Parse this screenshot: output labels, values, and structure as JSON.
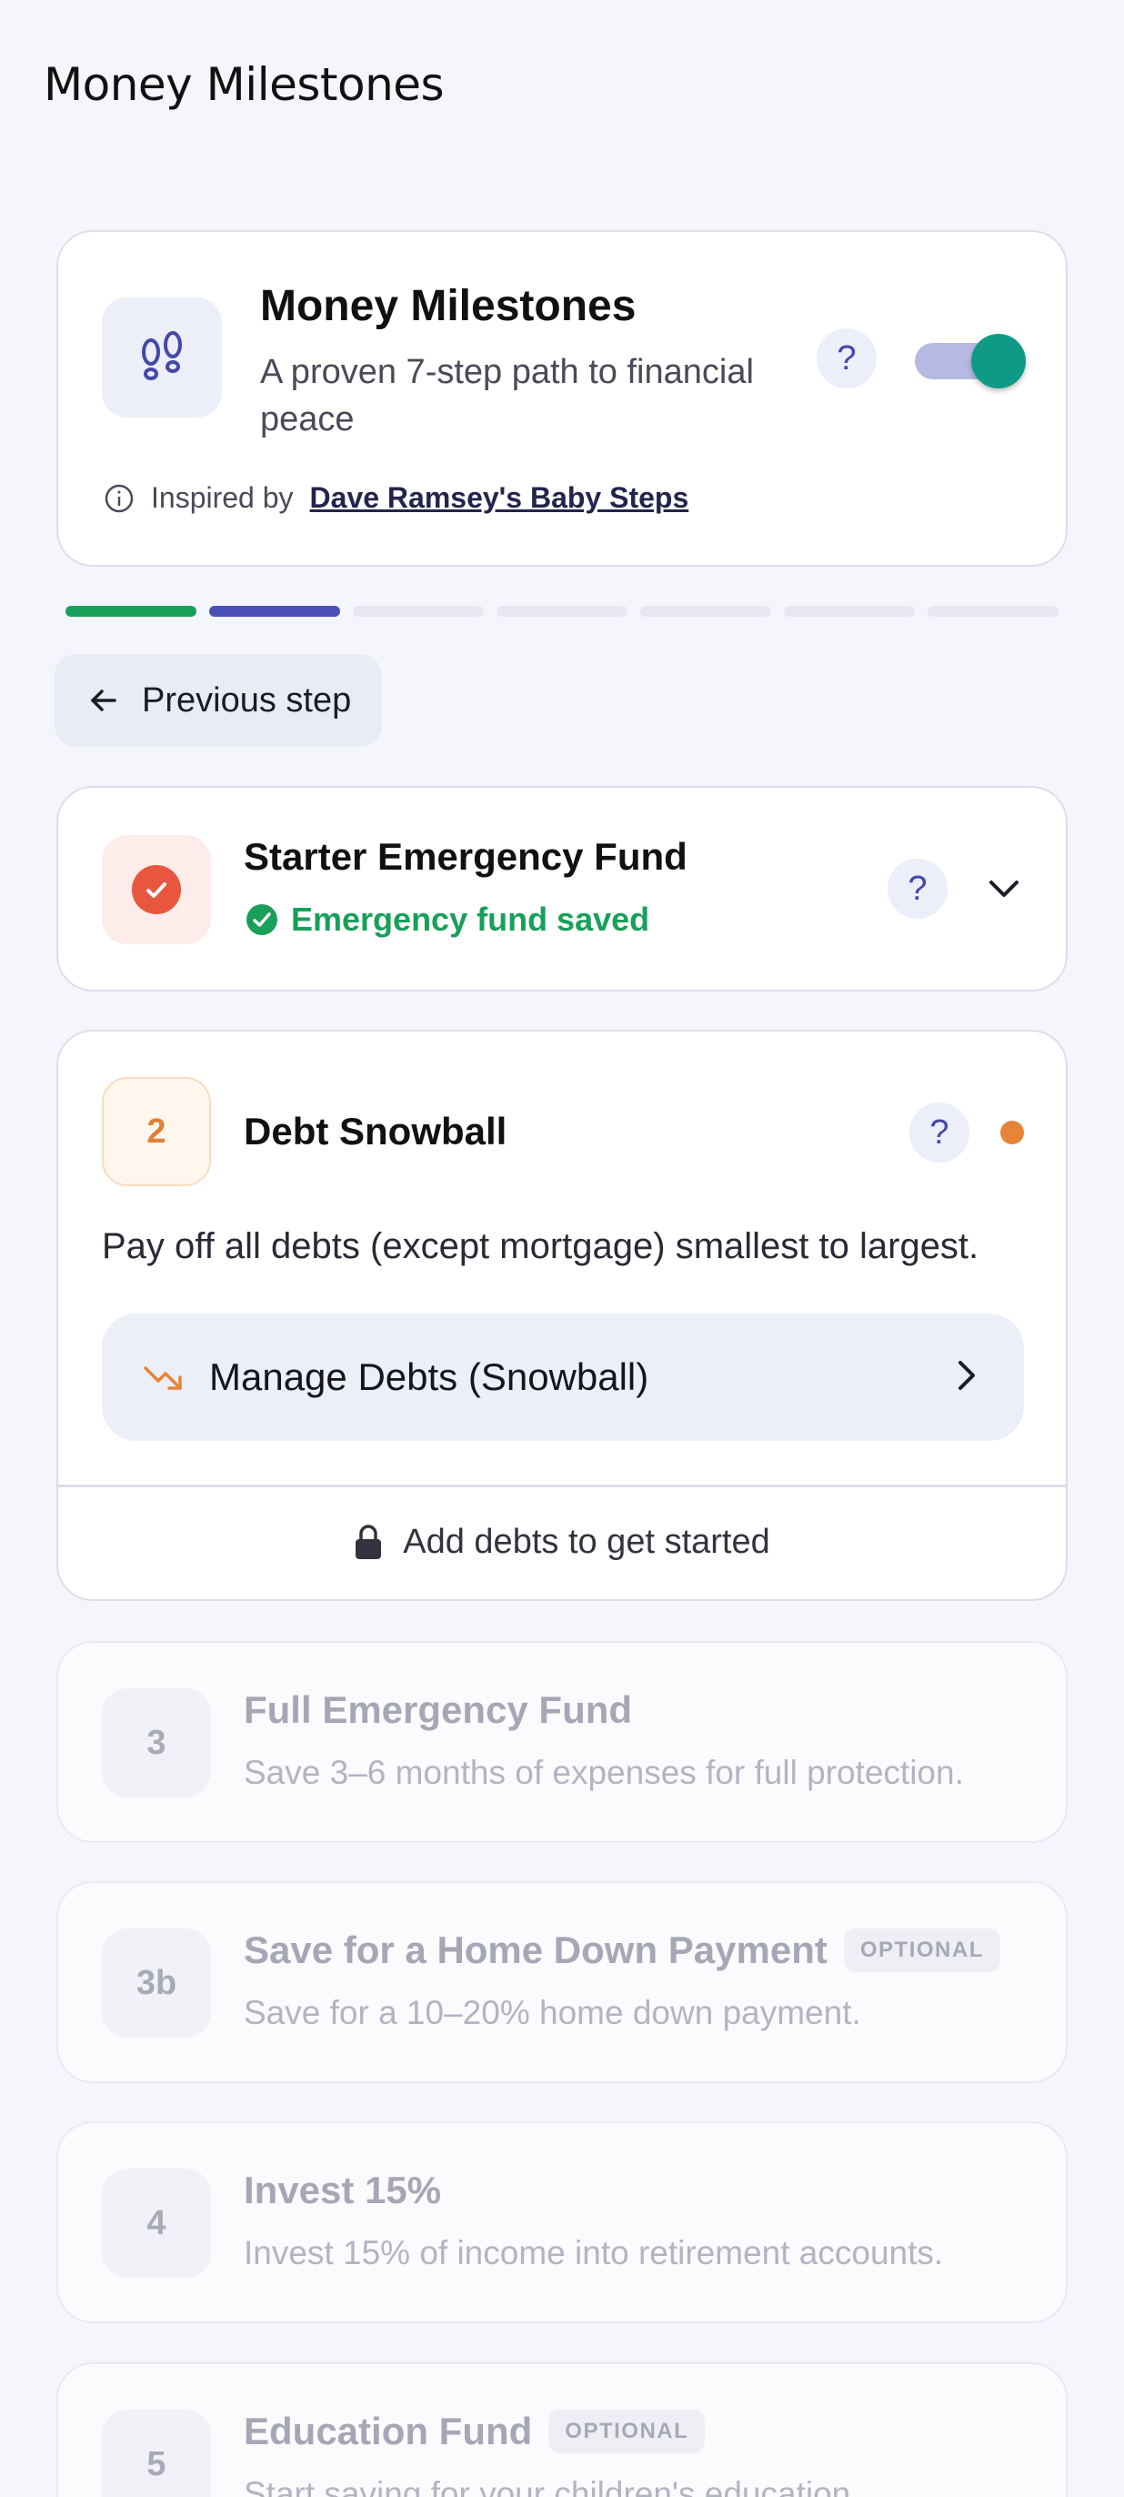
{
  "page": {
    "title": "Money Milestones"
  },
  "header_card": {
    "title": "Money Milestones",
    "subtitle": "A proven 7-step path to financial peace",
    "help_label": "?",
    "toggle_on": true,
    "inspired_prefix": "Inspired by",
    "inspired_link": "Dave Ramsey's Baby Steps",
    "icon": "footsteps-icon"
  },
  "progress": {
    "segments": [
      {
        "state": "complete",
        "color": "#18a05a"
      },
      {
        "state": "current",
        "color": "#4a4fb8"
      },
      {
        "state": "todo",
        "color": "#e6e7f0"
      },
      {
        "state": "todo",
        "color": "#e6e7f0"
      },
      {
        "state": "todo",
        "color": "#e6e7f0"
      },
      {
        "state": "todo",
        "color": "#e6e7f0"
      },
      {
        "state": "todo",
        "color": "#e6e7f0"
      }
    ]
  },
  "prev_button": {
    "label": "Previous step",
    "icon": "arrow-left-icon"
  },
  "steps": [
    {
      "title": "Starter Emergency Fund",
      "status": "Emergency fund saved",
      "help_label": "?",
      "state": "complete"
    },
    {
      "number": "2",
      "title": "Debt Snowball",
      "help_label": "?",
      "description": "Pay off all debts (except mortgage) smallest to largest.",
      "action_label": "Manage Debts (Snowball)",
      "footer": "Add debts to get started",
      "state": "active"
    },
    {
      "number": "3",
      "title": "Full Emergency Fund",
      "description": "Save 3–6 months of expenses for full protection.",
      "state": "locked"
    },
    {
      "number": "3b",
      "title": "Save for a Home Down Payment",
      "badge": "OPTIONAL",
      "description": "Save for a 10–20% home down payment.",
      "state": "locked"
    },
    {
      "number": "4",
      "title": "Invest 15%",
      "description": "Invest 15% of income into retirement accounts.",
      "state": "locked"
    },
    {
      "number": "5",
      "title": "Education Fund",
      "badge": "OPTIONAL",
      "description": "Start saving for your children's education.",
      "state": "locked"
    }
  ],
  "colors": {
    "accent": "#4548a8",
    "success": "#18a05a",
    "warning": "#e68438",
    "toggle": "#0f9a88"
  }
}
